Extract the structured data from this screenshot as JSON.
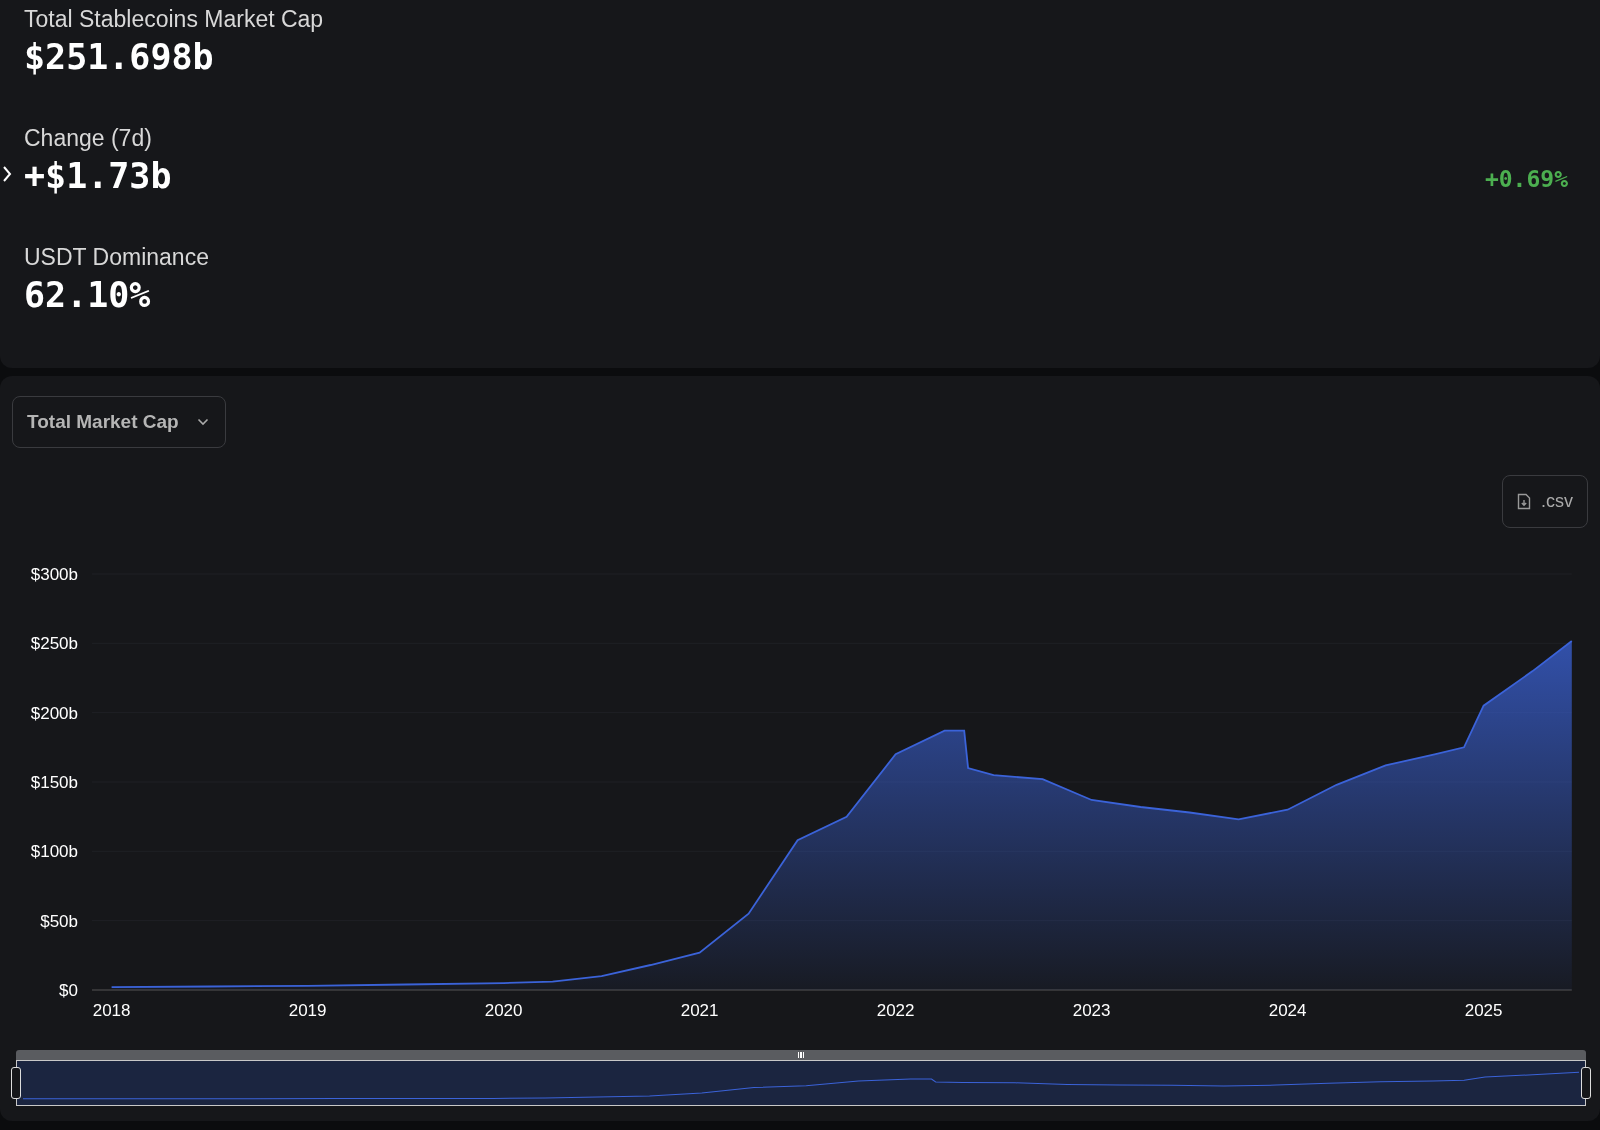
{
  "stats": [
    {
      "label": "Total Stablecoins Market Cap",
      "value": "$251.698b"
    },
    {
      "label": "Change (7d)",
      "value": "+$1.73b",
      "percent": "+0.69%",
      "expandable": true
    },
    {
      "label": "USDT Dominance",
      "value": "62.10%"
    }
  ],
  "chart_panel": {
    "metric_dropdown": {
      "value": "Total Market Cap"
    },
    "csv_button": {
      "label": ".csv"
    },
    "chart_data": {
      "type": "area",
      "x": [
        2018,
        2018.5,
        2019,
        2019.5,
        2020,
        2020.25,
        2020.5,
        2020.75,
        2021,
        2021.25,
        2021.5,
        2021.75,
        2022,
        2022.25,
        2022.35,
        2022.37,
        2022.5,
        2022.75,
        2023,
        2023.25,
        2023.5,
        2023.75,
        2024,
        2024.25,
        2024.5,
        2024.75,
        2024.9,
        2025,
        2025.25,
        2025.45
      ],
      "xlim": [
        2017.9,
        2025.45
      ],
      "grid": true,
      "series": [
        {
          "color": "#3b63d9",
          "values": [
            2,
            2.5,
            3,
            4,
            5,
            6,
            10,
            18,
            27,
            55,
            108,
            125,
            170,
            187,
            187,
            160,
            155,
            152,
            137,
            132,
            128,
            123,
            130,
            148,
            162,
            170,
            175,
            205,
            230,
            251.7
          ]
        }
      ],
      "xticks": [
        {
          "value": 2018,
          "label": "2018"
        },
        {
          "value": 2019,
          "label": "2019"
        },
        {
          "value": 2020,
          "label": "2020"
        },
        {
          "value": 2021,
          "label": "2021"
        },
        {
          "value": 2022,
          "label": "2022"
        },
        {
          "value": 2023,
          "label": "2023"
        },
        {
          "value": 2024,
          "label": "2024"
        },
        {
          "value": 2025,
          "label": "2025"
        }
      ],
      "yticks": [
        {
          "value": 0,
          "label": "$0"
        },
        {
          "value": 50,
          "label": "$50b"
        },
        {
          "value": 100,
          "label": "$100b"
        },
        {
          "value": 150,
          "label": "$150b"
        },
        {
          "value": 200,
          "label": "$200b"
        },
        {
          "value": 250,
          "label": "$250b"
        },
        {
          "value": 300,
          "label": "$300b"
        }
      ],
      "ylim": [
        0,
        300
      ]
    },
    "range_slider": {
      "level": 1
    }
  }
}
